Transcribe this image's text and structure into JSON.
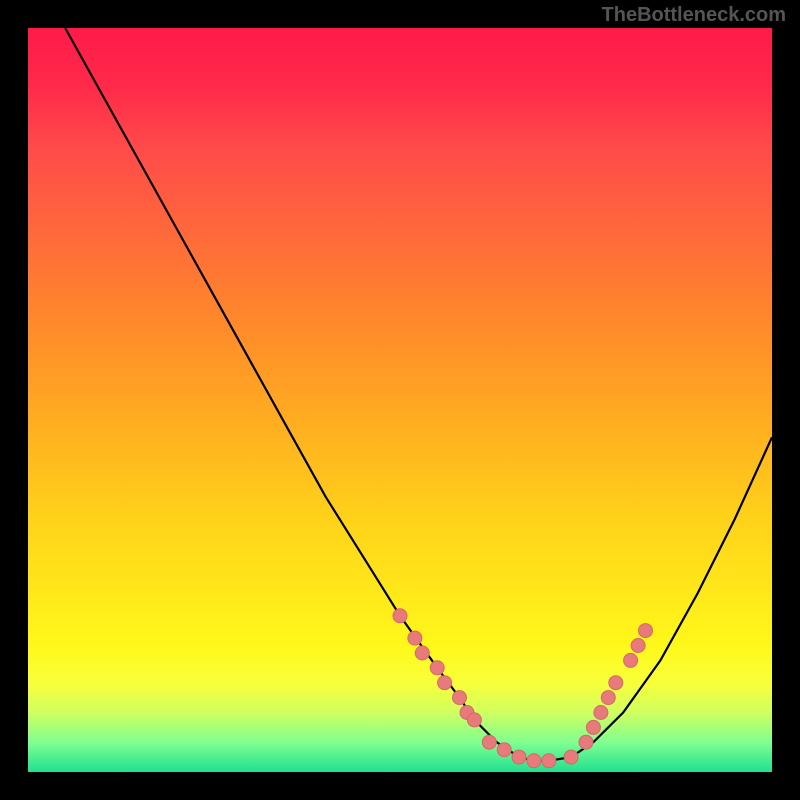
{
  "watermark": "TheBottleneck.com",
  "chart_data": {
    "type": "line",
    "title": "",
    "xlabel": "",
    "ylabel": "",
    "xlim": [
      0,
      100
    ],
    "ylim": [
      0,
      100
    ],
    "series": [
      {
        "name": "curve",
        "x": [
          5,
          10,
          15,
          20,
          25,
          30,
          35,
          40,
          45,
          50,
          55,
          58,
          60,
          63,
          66,
          68,
          70,
          73,
          76,
          80,
          85,
          90,
          95,
          100
        ],
        "y": [
          100,
          91,
          82,
          73,
          64,
          55,
          46,
          37,
          29,
          21,
          14,
          10,
          7,
          4,
          2,
          1.5,
          1.5,
          2,
          4,
          8,
          15,
          24,
          34,
          45
        ]
      }
    ],
    "markers": [
      {
        "x": 50,
        "y": 21
      },
      {
        "x": 52,
        "y": 18
      },
      {
        "x": 53,
        "y": 16
      },
      {
        "x": 55,
        "y": 14
      },
      {
        "x": 56,
        "y": 12
      },
      {
        "x": 58,
        "y": 10
      },
      {
        "x": 59,
        "y": 8
      },
      {
        "x": 60,
        "y": 7
      },
      {
        "x": 62,
        "y": 4
      },
      {
        "x": 64,
        "y": 3
      },
      {
        "x": 66,
        "y": 2
      },
      {
        "x": 68,
        "y": 1.5
      },
      {
        "x": 70,
        "y": 1.5
      },
      {
        "x": 73,
        "y": 2
      },
      {
        "x": 75,
        "y": 4
      },
      {
        "x": 76,
        "y": 6
      },
      {
        "x": 77,
        "y": 8
      },
      {
        "x": 78,
        "y": 10
      },
      {
        "x": 79,
        "y": 12
      },
      {
        "x": 81,
        "y": 15
      },
      {
        "x": 82,
        "y": 17
      },
      {
        "x": 83,
        "y": 19
      }
    ],
    "colors": {
      "curve": "#000000",
      "marker_fill": "#e77a7a",
      "marker_stroke": "#d66868"
    }
  }
}
